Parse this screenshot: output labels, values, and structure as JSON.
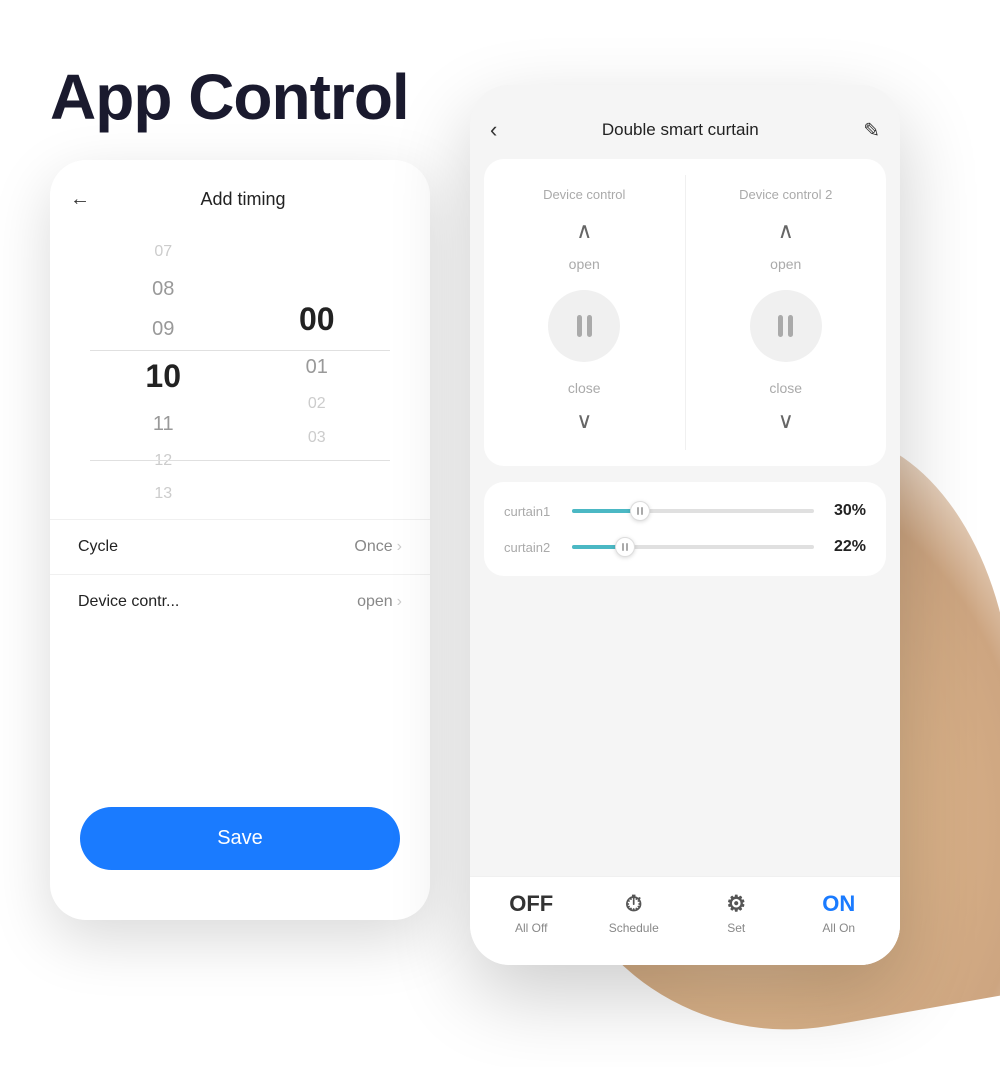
{
  "page": {
    "title": "App Control",
    "background": "#ffffff"
  },
  "left_phone": {
    "header": {
      "back_icon": "←",
      "title": "Add timing"
    },
    "time_picker": {
      "hours": [
        "07",
        "08",
        "09",
        "10",
        "11",
        "12",
        "13"
      ],
      "selected_hour": "10",
      "minutes": [
        "00",
        "01",
        "02",
        "03"
      ],
      "selected_minute": "00"
    },
    "settings": [
      {
        "label": "Cycle",
        "value": "Once"
      },
      {
        "label": "Device contr...",
        "value": "open"
      }
    ],
    "save_button": "Save"
  },
  "right_phone": {
    "header": {
      "back_icon": "‹",
      "title": "Double smart curtain",
      "edit_icon": "✎"
    },
    "device_col1": {
      "label": "Device control",
      "open_label": "open",
      "close_label": "close"
    },
    "device_col2": {
      "label": "Device control 2",
      "open_label": "open",
      "close_label": "close"
    },
    "sliders": [
      {
        "name": "curtain1",
        "percent": 30,
        "fill_pct": 28
      },
      {
        "name": "curtain2",
        "percent": 22,
        "fill_pct": 22
      }
    ],
    "bottom_bar": [
      {
        "id": "off",
        "icon": "OFF",
        "label": "All Off"
      },
      {
        "id": "schedule",
        "icon": "⏱",
        "label": "Schedule"
      },
      {
        "id": "set",
        "icon": "⚙",
        "label": "Set"
      },
      {
        "id": "on",
        "icon": "ON",
        "label": "All On"
      }
    ]
  }
}
